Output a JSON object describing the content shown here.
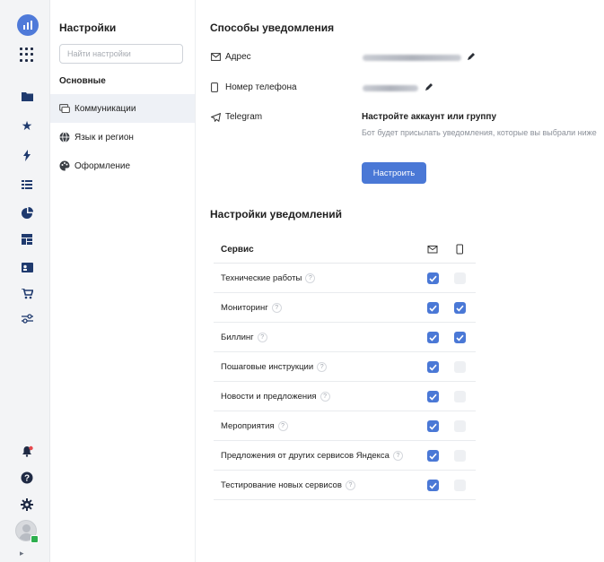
{
  "menu": {
    "title": "Настройки",
    "search_placeholder": "Найти настройки",
    "section": "Основные",
    "items": [
      {
        "label": "Коммуникации",
        "active": true,
        "icon": "chat-icon"
      },
      {
        "label": "Язык и регион",
        "active": false,
        "icon": "globe-icon"
      },
      {
        "label": "Оформление",
        "active": false,
        "icon": "palette-icon"
      }
    ]
  },
  "rail": {
    "icons": [
      "logo-icon",
      "apps-grid-icon",
      "folder-icon",
      "star-icon",
      "lightning-icon",
      "list-icon",
      "pie-chart-icon",
      "dashboard-icon",
      "id-card-icon",
      "cart-icon",
      "sliders-icon",
      "notification-bell-icon",
      "help-icon",
      "gear-icon",
      "avatar"
    ]
  },
  "notify_methods": {
    "title": "Способы уведомления",
    "email_label": "Адрес",
    "phone_label": "Номер телефона",
    "telegram_label": "Telegram",
    "telegram_title": "Настройте аккаунт или группу",
    "telegram_desc": "Бот будет присылать уведомления, которые вы выбрали ниже",
    "configure_button": "Настроить"
  },
  "notify_settings": {
    "title": "Настройки уведомлений",
    "service_header": "Сервис",
    "rows": [
      {
        "label": "Технические работы",
        "email": true,
        "phone": false
      },
      {
        "label": "Мониторинг",
        "email": true,
        "phone": true
      },
      {
        "label": "Биллинг",
        "email": true,
        "phone": true
      },
      {
        "label": "Пошаговые инструкции",
        "email": true,
        "phone": false
      },
      {
        "label": "Новости и предложения",
        "email": true,
        "phone": false
      },
      {
        "label": "Мероприятия",
        "email": true,
        "phone": false
      },
      {
        "label": "Предложения от других сервисов Яндекса",
        "email": true,
        "phone": false
      },
      {
        "label": "Тестирование новых сервисов",
        "email": true,
        "phone": false
      }
    ]
  },
  "colors": {
    "accent": "#4a78d6",
    "rail_bg": "#f3f4f6",
    "active_item_bg": "#eef1f6"
  }
}
